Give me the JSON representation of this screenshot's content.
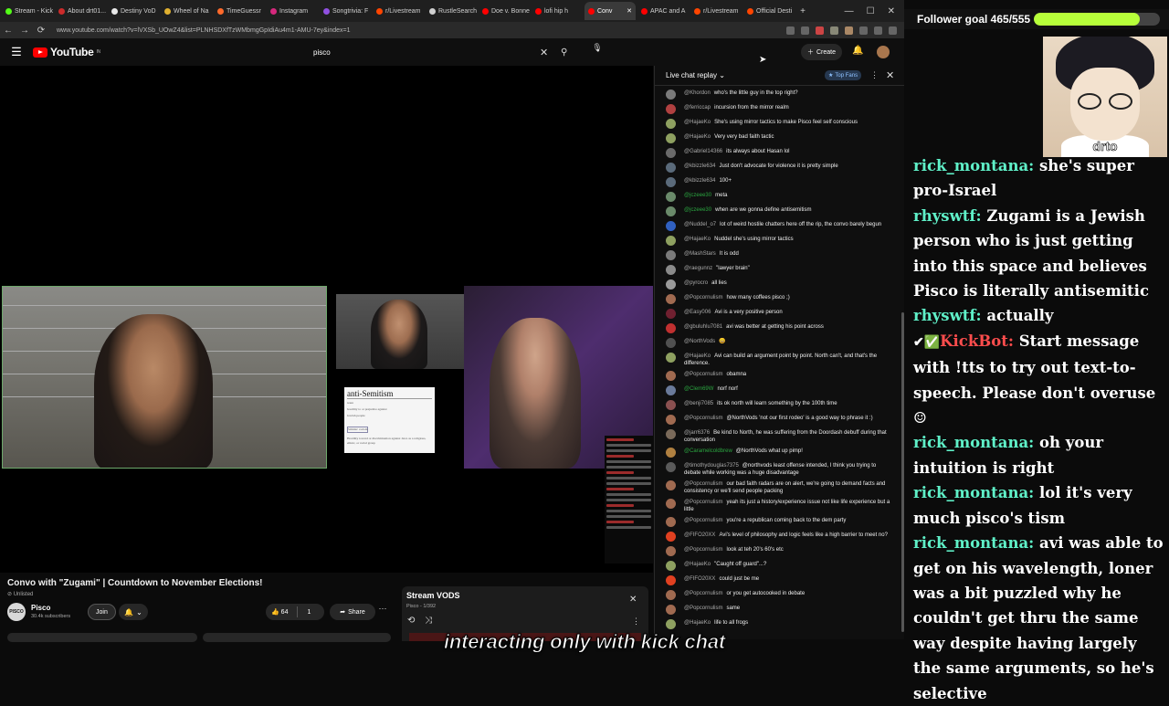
{
  "browser": {
    "tabs": [
      {
        "label": "Stream - Kick",
        "color": "#53fc18"
      },
      {
        "label": "About drt01...",
        "color": "#cc2b2b"
      },
      {
        "label": "Destiny VoD",
        "color": "#e8e8e8"
      },
      {
        "label": "Wheel of Na",
        "color": "#e0b030"
      },
      {
        "label": "TimeGuessr",
        "color": "#ff6a2b"
      },
      {
        "label": "Instagram",
        "color": "#d6287d"
      },
      {
        "label": "Songtrivia: F",
        "color": "#9050e0"
      },
      {
        "label": "r/Livestream",
        "color": "#ff4500"
      },
      {
        "label": "RustleSearch",
        "color": "#cfcfcf"
      },
      {
        "label": "Doe v. Bonne",
        "color": "#ff0000"
      },
      {
        "label": "lofi hip h",
        "color": "#ff0000"
      },
      {
        "label": "Conv",
        "color": "#ff0000",
        "active": true
      },
      {
        "label": "APAC and A",
        "color": "#ff0000"
      },
      {
        "label": "r/Livestream",
        "color": "#ff4500"
      },
      {
        "label": "Official Desti",
        "color": "#ff4500"
      }
    ],
    "url": "www.youtube.com/watch?v=lVXSb_UOwZ4&list=PLNHSDXfTzWMbmgGpIdiAu4m1-AMU-7ey&index=1"
  },
  "youtube": {
    "logo": "YouTube",
    "logo_sup": "IN",
    "search_value": "pisco",
    "create_label": "Create"
  },
  "video": {
    "anti_heading": "anti-Semitism",
    "anti_lines": [
      "noun",
      "hostility to or prejudice against",
      "Jewish people",
      "Similar: racism",
      "Hostility toward or discrimination against Jews as a religious, ethnic, or racial group"
    ]
  },
  "meta": {
    "title": "Convo with \"Zugami\" | Countdown to November Elections!",
    "unlisted": "Unlisted",
    "channel_avatar": "PISCO",
    "channel_name": "Pisco",
    "subscribers": "30.4k subscribers",
    "join_label": "Join",
    "likes": "64",
    "dislikes": "1",
    "share_label": "Share"
  },
  "playlist": {
    "title": "Stream VODS",
    "subtitle": "Pisco - 1/392"
  },
  "chat": {
    "header": "Live chat replay",
    "top_fans": "Top Fans",
    "messages": [
      {
        "name": "@Khordon",
        "text": "who's the little guy in the top right?",
        "color": "#7a7a7a"
      },
      {
        "name": "@ferriccap",
        "text": "incursion from the mirror realm",
        "color": "#b04040"
      },
      {
        "name": "@HajaeKo",
        "text": "She's using mirror tactics to make Pisco feel self conscious",
        "color": "#8ea060"
      },
      {
        "name": "@HajaeKo",
        "text": "Very very bad faith tactic",
        "color": "#8ea060"
      },
      {
        "name": "@Gabriel14366",
        "text": "its always about Hasan lol",
        "color": "#6a6a6a"
      },
      {
        "name": "@kbizzle634",
        "text": "Just don't advocate for violence it is pretty simple",
        "color": "#5a6a7a"
      },
      {
        "name": "@kbizzle634",
        "text": "100+",
        "color": "#5a6a7a"
      },
      {
        "name": "@jczeee30",
        "text": "meta",
        "color": "#6a8a6a",
        "mod": true
      },
      {
        "name": "@jczeee30",
        "text": "when are we gonna define antisemitism",
        "color": "#6a8a6a",
        "mod": true
      },
      {
        "name": "@Nuddel_o7",
        "text": "lot of weird hostile chatters here off the rip, the convo barely begun",
        "color": "#3060c0"
      },
      {
        "name": "@HajaeKo",
        "text": "Nuddel she's using mirror tactics",
        "color": "#8ea060"
      },
      {
        "name": "@MashStars",
        "text": "It is odd",
        "color": "#7a7a7a"
      },
      {
        "name": "@raegunnz",
        "text": "\"lawyer brain\"",
        "color": "#8a8a8a"
      },
      {
        "name": "@pyrocro",
        "text": "all lies",
        "color": "#9a9a9a"
      },
      {
        "name": "@Popcornulism",
        "text": "how many coffees pisco ;)",
        "color": "#a06a50"
      },
      {
        "name": "@Easy006",
        "text": "Avi is a very positive person",
        "color": "#702030"
      },
      {
        "name": "@gbuluhlu7081",
        "text": "avi was better at getting his point across",
        "color": "#c03030"
      },
      {
        "name": "@NorthVods",
        "text": "😀",
        "color": "#505050"
      },
      {
        "name": "@HajaeKo",
        "text": "Avi can build an argument point by point. North can't, and that's the difference.",
        "color": "#8ea060"
      },
      {
        "name": "@Popcornulism",
        "text": "obamna",
        "color": "#a06a50"
      },
      {
        "name": "@Clem69W",
        "text": "norf norf",
        "color": "#6a7a9a",
        "mod": true
      },
      {
        "name": "@benji7085",
        "text": "its ok north will learn something by the 100th time",
        "color": "#8a5050"
      },
      {
        "name": "@Popcornulism",
        "text": "@NorthVods 'not our first rodeo' is a good way to phrase it :)",
        "color": "#a06a50"
      },
      {
        "name": "@jarr6376",
        "text": "Be kind to North, he was suffering from the Doordash debuff during that conversation",
        "color": "#7a6a5a"
      },
      {
        "name": "@Caramelcoldbrew",
        "text": "@NorthVods what up pimp!",
        "color": "#b08040",
        "mod": true
      },
      {
        "name": "@timothydouglas7375",
        "text": "@northvods least offense intended, I think you trying to debate while working was a huge disadvantage",
        "color": "#5a5a5a"
      },
      {
        "name": "@Popcornulism",
        "text": "our bad faith radars are on alert, we're going to demand facts and consistency or we'll send people packing",
        "color": "#a06a50"
      },
      {
        "name": "@Popcornulism",
        "text": "yeah its just a history/experience issue not like life experience but a little",
        "color": "#a06a50"
      },
      {
        "name": "@Popcornulism",
        "text": "you're a republican coming back to the dem party",
        "color": "#a06a50"
      },
      {
        "name": "@FIFO20XX",
        "text": "Avi's level of philosophy and logic feels like a high barrier to meet no?",
        "color": "#e04020"
      },
      {
        "name": "@Popcornulism",
        "text": "look at teh 20's 60's etc",
        "color": "#a06a50"
      },
      {
        "name": "@HajaeKo",
        "text": "\"Caught off guard\"...?",
        "color": "#8ea060"
      },
      {
        "name": "@FIFO20XX",
        "text": "could just be me",
        "color": "#e04020"
      },
      {
        "name": "@Popcornulism",
        "text": "or you get autocooked in debate",
        "color": "#a06a50"
      },
      {
        "name": "@Popcornulism",
        "text": "same",
        "color": "#a06a50"
      },
      {
        "name": "@HajaeKo",
        "text": "life to all frogs",
        "color": "#8ea060"
      }
    ]
  },
  "overlay": {
    "goal_text": "Follower goal 465/555",
    "goal_progress": 0.838,
    "avatar_label": "drto",
    "kick_messages": [
      {
        "user": "rick_montana:",
        "text": "she's super pro-Israel"
      },
      {
        "user": "rhyswtf:",
        "text": "Zugami is a Jewish person who is just getting into this space and believes Pisco is literally antisemitic"
      },
      {
        "user": "rhyswtf:",
        "text": "actually"
      },
      {
        "user": "KickBot:",
        "text": "Start message with !tts to try out text-to-speech. Please don't overuse ☺",
        "badges": "✔✅",
        "bot": true
      },
      {
        "user": "rick_montana:",
        "text": "oh your intuition is right"
      },
      {
        "user": "rick_montana:",
        "text": "lol it's very much pisco's tism"
      },
      {
        "user": "rick_montana:",
        "text": "avi was able to get on his wavelength, loner was a bit puzzled why he couldn't get thru the same way despite having largely the same arguments, so he's selective"
      }
    ]
  },
  "caption": "interacting only with kick chat"
}
